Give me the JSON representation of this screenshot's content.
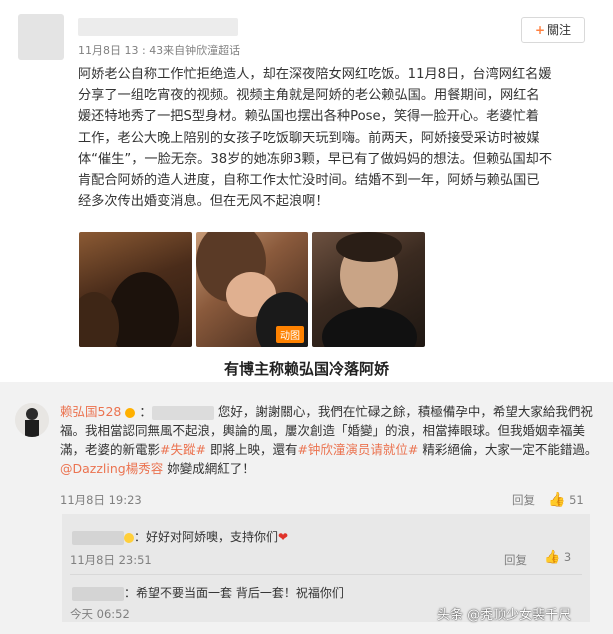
{
  "post": {
    "meta": "11月8日 13 : 43来自钟欣潼超话",
    "follow_label": "關注",
    "text_lines": [
      "阿娇老公自称工作忙拒绝造人，却在深夜陪女网红吃饭。11月8日，台湾网红名媛",
      "分享了一组吃宵夜的视频。视频主角就是阿娇的老公赖弘国。用餐期间，网红名",
      "媛还特地秀了一把S型身材。赖弘国也摆出各种Pose，笑得一脸开心。老婆忙着",
      "工作，老公大晚上陪别的女孩子吃饭聊天玩到嗨。前两天，阿娇接受采访时被媒",
      "体“催生”，一脸无奈。38岁的她冻卵3颗，早已有了做妈妈的想法。但赖弘国却不",
      "肯配合阿娇的造人进度，自称工作太忙没时间。结婚不到一年，阿娇与赖弘国已",
      "经多次传出婚变消息。但在无风不起浪啊！"
    ],
    "gif_badge": "动图",
    "caption": "有博主称赖弘国冷落阿娇"
  },
  "comment": {
    "author": "赖弘国528",
    "line1_after_blur": "您好，謝謝關心，我們在忙碌之餘，積極備孕中，希望大家給我們祝",
    "line2": "福。我相當認同無風不起浪，輿論的風，屢次創造「婚變」的浪，相當捧眼球。但我婚姻幸福美",
    "line3_a": "滿，老婆的新電影",
    "line3_tag1": "#失蹤#",
    "line3_b": " 即將上映，還有",
    "line3_tag2": "#钟欣潼演员请就位#",
    "line3_c": " 精彩絕倫，大家一定不能錯過。",
    "line4_mention": "@Dazzling楊秀容",
    "line4_text": " 妳變成網紅了！",
    "time": "11月8日 19:23",
    "reply_label": "回复",
    "like_count": "51"
  },
  "replies": [
    {
      "text": "：好好对阿娇噢，支持你们",
      "time": "11月8日 23:51",
      "reply_label": "回复",
      "like_count": "3"
    },
    {
      "text": "：希望不要当面一套 背后一套！祝福你们",
      "time": "今天 06:52"
    }
  ],
  "watermark": "头条 @秃顶少女裴千尺",
  "colors": {
    "link": "#eb7350",
    "follow_plus": "#ff8140",
    "comment_bg": "#f2f2f2"
  }
}
